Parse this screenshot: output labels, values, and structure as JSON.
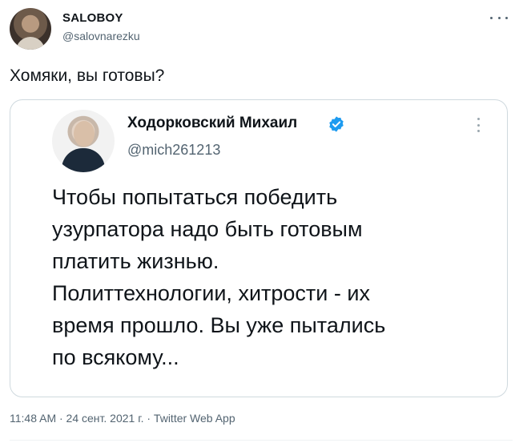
{
  "author": {
    "name": "SALOBOY",
    "handle": "@salovnarezku"
  },
  "tweet": {
    "text": "Хомяки, вы готовы?"
  },
  "quoted": {
    "name": "Ходорковский Михаил",
    "handle": "@mich261213",
    "lines": [
      "Чтобы попытаться победить",
      "узурпатора надо быть готовым",
      "платить жизнью.",
      "Политтехнологии, хитрости - их",
      "время прошло. Вы уже пытались",
      "по всякому..."
    ],
    "verified_color": "#1d9bf0"
  },
  "meta": {
    "timestamp": "11:48 AM · 24 сент. 2021 г. · Twitter Web App"
  },
  "icons": {
    "more": "more-horizontal-icon",
    "verified": "verified-badge-icon",
    "quote_more": "more-vertical-icon"
  }
}
